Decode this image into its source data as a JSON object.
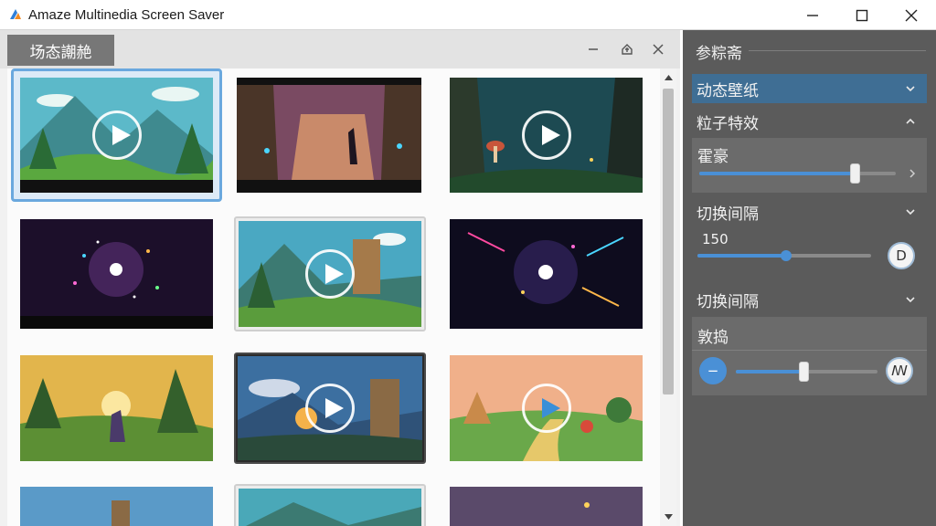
{
  "window": {
    "title": "Amaze Multinedia Screen Saver",
    "controls": [
      "minimize-icon",
      "maximize-icon",
      "close-icon"
    ]
  },
  "gallery": {
    "tab_label": "场态謿赩",
    "header_icons": [
      "minus-icon",
      "pin-icon",
      "close-icon"
    ],
    "thumbnails": [
      {
        "scene": "forest-mountains",
        "has_play": true,
        "selected": true
      },
      {
        "scene": "fantasy-ruins",
        "has_play": false
      },
      {
        "scene": "mushroom-cave",
        "has_play": true
      },
      {
        "scene": "particle-burst",
        "has_play": false
      },
      {
        "scene": "castle-tower",
        "has_play": true
      },
      {
        "scene": "particle-burst-dark",
        "has_play": false
      },
      {
        "scene": "sunset-forest",
        "has_play": false
      },
      {
        "scene": "dusk-tower",
        "has_play": true
      },
      {
        "scene": "meadow-village",
        "has_play": true
      }
    ]
  },
  "settings": {
    "title": "参粽斋",
    "dynamic_wallpaper": "动态壁纸",
    "particle_effects": "粒子特效",
    "card1_label": "霍豪",
    "slider1_level": 0.79,
    "switch_interval_1": "切换间隔",
    "interval_value": "150",
    "btn_d": "D",
    "slider2_level": 0.51,
    "switch_interval_2": "切换间隔",
    "card3_label": "敦捣",
    "slider3_level": 0.48,
    "btn_minus": "−",
    "btn_w": "ꟿ"
  },
  "colors": {
    "accent": "#4a90d6",
    "dropdown_bg": "#3f6e94",
    "panel_bg": "#5b5b5b",
    "tab_bg": "#777777"
  }
}
